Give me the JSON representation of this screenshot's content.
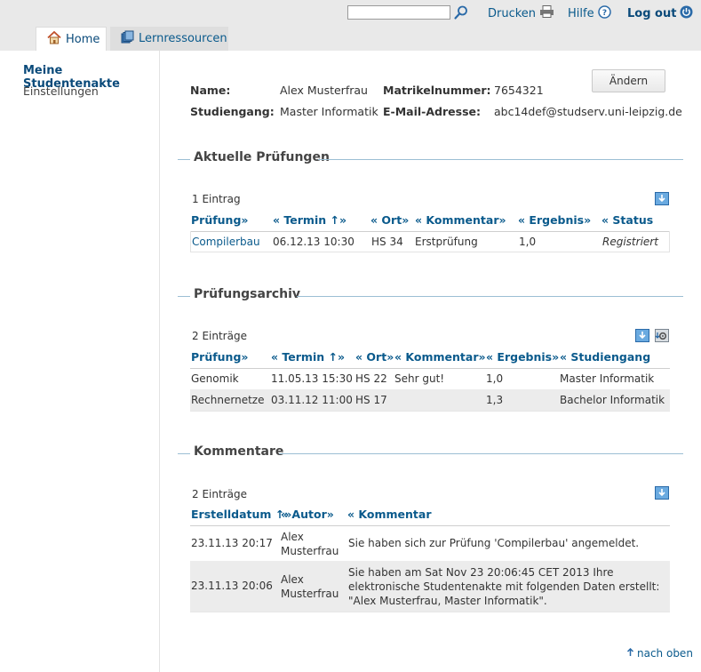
{
  "header": {
    "search_placeholder": "",
    "print_label": "Drucken",
    "help_label": "Hilfe",
    "logout_label": "Log out",
    "tabs": [
      {
        "label": "Home",
        "icon": "home-icon"
      },
      {
        "label": "Lernressourcen",
        "icon": "books-icon"
      }
    ]
  },
  "sidebar": {
    "items": [
      {
        "label": "Meine Studentenakte"
      },
      {
        "label": "Einstellungen"
      }
    ]
  },
  "profile": {
    "name_label": "Name:",
    "name_value": "Alex Musterfrau",
    "program_label": "Studiengang:",
    "program_value": "Master Informatik",
    "matrikel_label": "Matrikelnummer:",
    "matrikel_value": "7654321",
    "email_label": "E-Mail-Adresse:",
    "email_value": "abc14def@studserv.uni-leipzig.de",
    "edit_button": "Ändern"
  },
  "current_exams": {
    "title": "Aktuelle Prüfungen",
    "count": "1 Eintrag",
    "headers": [
      "Prüfung»",
      "« Termin ↑»",
      "« Ort»",
      "« Kommentar»",
      "« Ergebnis»",
      "« Status"
    ],
    "rows": [
      [
        "Compilerbau",
        "06.12.13 10:30",
        "HS 34",
        "Erstprüfung",
        "1,0",
        "Registriert"
      ]
    ]
  },
  "archive": {
    "title": "Prüfungsarchiv",
    "count": "2 Einträge",
    "headers": [
      "Prüfung»",
      "« Termin ↑»",
      "« Ort»",
      "« Kommentar»",
      "« Ergebnis»",
      "« Studiengang"
    ],
    "rows": [
      [
        "Genomik",
        "11.05.13 15:30",
        "HS 22",
        "Sehr gut!",
        "1,0",
        "Master Informatik"
      ],
      [
        "Rechnernetze",
        "03.11.12 11:00",
        "HS 17",
        "",
        "1,3",
        "Bachelor Informatik"
      ]
    ]
  },
  "comments": {
    "title": "Kommentare",
    "count": "2 Einträge",
    "headers": [
      "Erstelldatum ↑»",
      "« Autor»",
      "« Kommentar"
    ],
    "rows": [
      [
        "23.11.13 20:17",
        "Alex Musterfrau",
        "Sie haben sich zur Prüfung 'Compilerbau' angemeldet."
      ],
      [
        "23.11.13 20:06",
        "Alex Musterfrau",
        "Sie haben am Sat Nov 23 20:06:45 CET 2013 Ihre elektronische Studentenakte mit folgenden Daten erstellt: \"Alex Musterfrau, Master Informatik\"."
      ]
    ]
  },
  "footer": {
    "to_top": "nach oben"
  }
}
